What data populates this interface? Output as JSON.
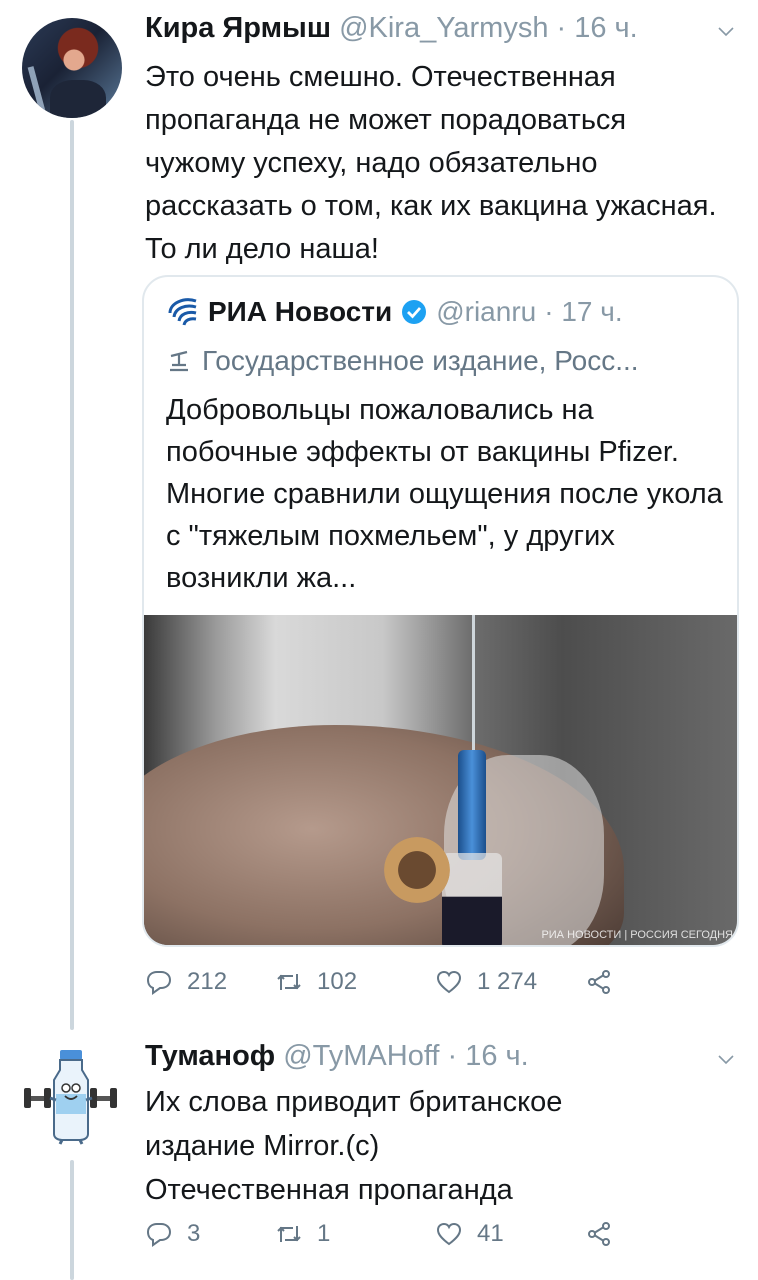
{
  "tweet1": {
    "name": "Кира Ярмыш",
    "handle": "@Kira_Yarmysh",
    "time": "· 16 ч.",
    "text": "Это очень смешно. Отечественная пропаганда не может порадоваться чужому успеху, надо обязательно рассказать о том, как их вакцина ужасная. То ли дело наша!",
    "quote": {
      "name": "РИА Новости",
      "handle": "@rianru",
      "time": "· 17 ч.",
      "label": "Государственное издание, Росс...",
      "text": "Добровольцы пожаловались на побочные эффекты от вакцины Pfizer. Многие сравнили ощущения после укола с \"тяжелым похмельем\", у других возникли жа...",
      "watermark": "РИА НОВОСТИ | РОССИЯ СЕГОДНЯ"
    },
    "stats": {
      "replies": "212",
      "retweets": "102",
      "likes": "1 274"
    }
  },
  "tweet2": {
    "name": "Туманоф",
    "handle": "@ТуMAHoff",
    "time": "· 16 ч.",
    "text_lines": [
      "Их слова приводит британское",
      "издание Mirror.(с)",
      "Отечественная пропаганда"
    ],
    "stats": {
      "replies": "3",
      "retweets": "1",
      "likes": "41"
    }
  },
  "icons": [
    "reply-icon",
    "retweet-icon",
    "like-icon",
    "share-icon",
    "chevron-down-icon",
    "verified-icon",
    "ria-logo-icon",
    "state-media-icon"
  ],
  "colors": {
    "text": "#14171a",
    "muted": "#657786",
    "meta": "#8899a6",
    "verified": "#1da1f2",
    "border": "#e1e8ed"
  }
}
